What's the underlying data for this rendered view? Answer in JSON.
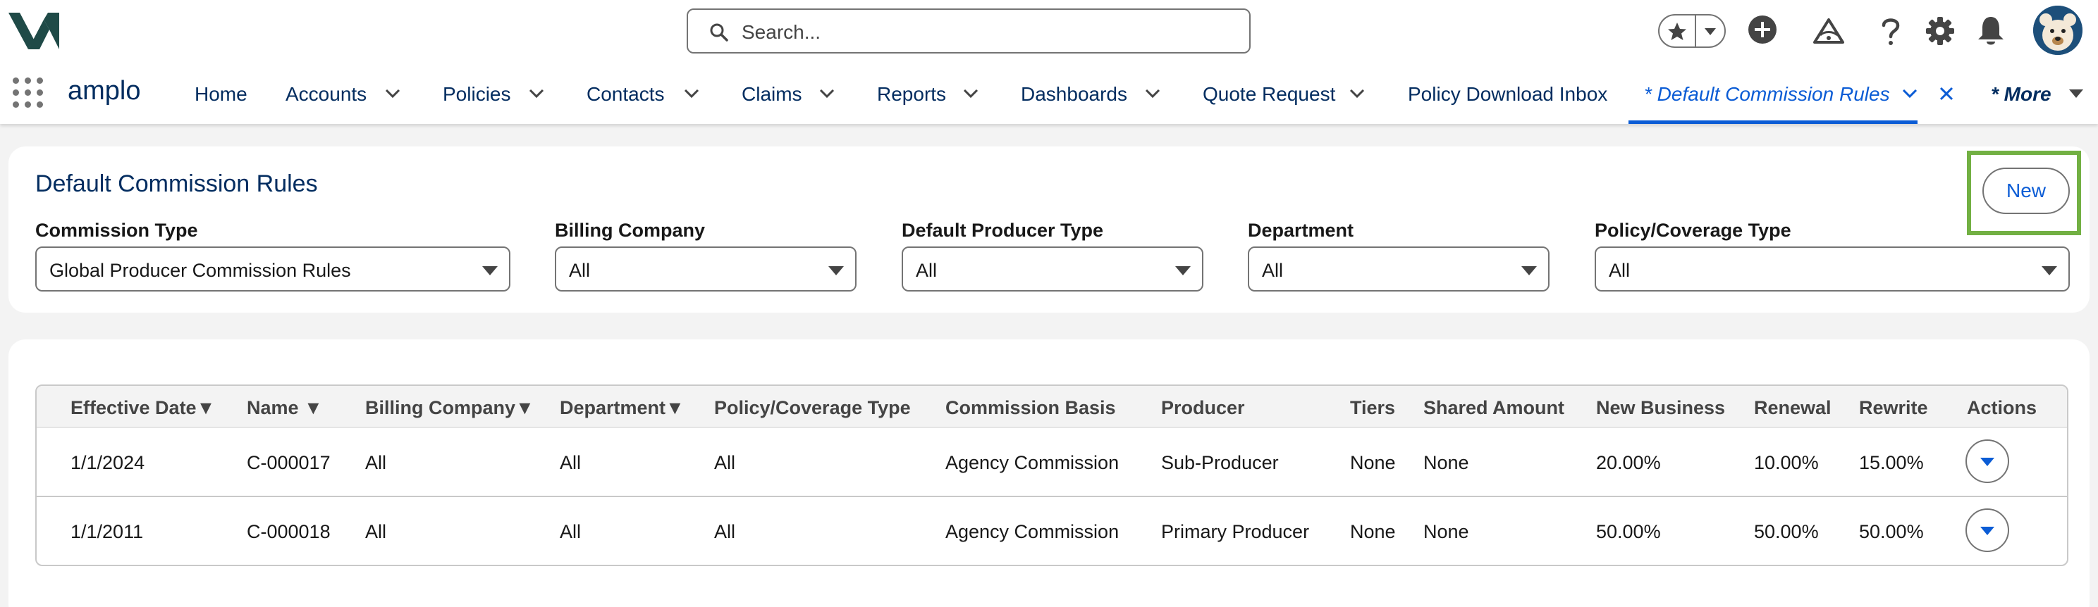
{
  "header": {
    "search_placeholder": "Search...",
    "icons": [
      "favorites-star-icon",
      "favorites-dropdown-icon",
      "global-actions-plus-icon",
      "trailhead-icon",
      "help-icon",
      "setup-gear-icon",
      "notifications-bell-icon",
      "user-avatar"
    ]
  },
  "nav": {
    "app_name": "amplo",
    "items": [
      {
        "label": "Home"
      },
      {
        "label": "Accounts"
      },
      {
        "label": "Policies"
      },
      {
        "label": "Contacts"
      },
      {
        "label": "Claims"
      },
      {
        "label": "Reports"
      },
      {
        "label": "Dashboards"
      },
      {
        "label": "Quote Request"
      },
      {
        "label": "Policy Download Inbox"
      }
    ],
    "active_tab": "* Default Commission Rules",
    "more_label": "* More"
  },
  "page": {
    "title": "Default Commission Rules",
    "new_button": "New",
    "accent_highlight": "#72b043",
    "filters": [
      {
        "label": "Commission Type",
        "value": "Global Producer Commission Rules"
      },
      {
        "label": "Billing Company",
        "value": "All"
      },
      {
        "label": "Default Producer Type",
        "value": "All"
      },
      {
        "label": "Department",
        "value": "All"
      },
      {
        "label": "Policy/Coverage Type",
        "value": "All"
      }
    ]
  },
  "table": {
    "columns": [
      "Effective Date▼",
      "Name ▼",
      "Billing Company▼",
      "Department▼",
      "Policy/Coverage Type",
      "Commission Basis",
      "Producer",
      "Tiers",
      "Shared Amount",
      "New Business",
      "Renewal",
      "Rewrite",
      "Actions"
    ],
    "rows": [
      [
        "1/1/2024",
        "C-000017",
        "All",
        "All",
        "All",
        "Agency Commission",
        "Sub-Producer",
        "None",
        "None",
        "20.00%",
        "10.00%",
        "15.00%"
      ],
      [
        "1/1/2011",
        "C-000018",
        "All",
        "All",
        "All",
        "Agency Commission",
        "Primary Producer",
        "None",
        "None",
        "50.00%",
        "50.00%",
        "50.00%"
      ]
    ]
  }
}
